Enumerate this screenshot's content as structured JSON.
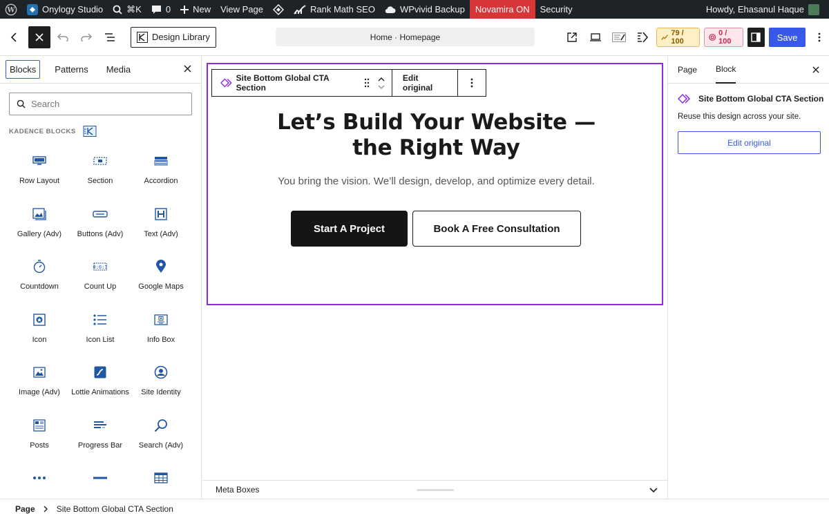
{
  "adminbar": {
    "site_name": "Onylogy Studio",
    "shortcut": "⌘K",
    "comments_count": "0",
    "new_label": "New",
    "view_page": "View Page",
    "rank_math": "Rank Math SEO",
    "wpvivid": "WPvivid Backup",
    "novamira": "Novamira ON",
    "security": "Security",
    "greeting": "Howdy, Ehasanul Haque"
  },
  "header": {
    "design_library": "Design Library",
    "doc_title": "Home · Homepage",
    "score_seo": "79 / 100",
    "score_other": "0 / 100",
    "save": "Save"
  },
  "left_panel": {
    "tabs": [
      "Blocks",
      "Patterns",
      "Media"
    ],
    "search_placeholder": "Search",
    "section_heading": "KADENCE BLOCKS",
    "blocks": [
      {
        "label": "Row Layout",
        "icon": "row-layout-icon"
      },
      {
        "label": "Section",
        "icon": "section-icon"
      },
      {
        "label": "Accordion",
        "icon": "accordion-icon"
      },
      {
        "label": "Gallery (Adv)",
        "icon": "gallery-icon"
      },
      {
        "label": "Buttons (Adv)",
        "icon": "buttons-icon"
      },
      {
        "label": "Text (Adv)",
        "icon": "text-icon"
      },
      {
        "label": "Countdown",
        "icon": "countdown-icon"
      },
      {
        "label": "Count Up",
        "icon": "count-up-icon"
      },
      {
        "label": "Google Maps",
        "icon": "map-pin-icon"
      },
      {
        "label": "Icon",
        "icon": "icon-block-icon"
      },
      {
        "label": "Icon List",
        "icon": "icon-list-icon"
      },
      {
        "label": "Info Box",
        "icon": "info-box-icon"
      },
      {
        "label": "Image (Adv)",
        "icon": "image-icon"
      },
      {
        "label": "Lottie Animations",
        "icon": "lottie-icon"
      },
      {
        "label": "Site Identity",
        "icon": "site-identity-icon"
      },
      {
        "label": "Posts",
        "icon": "posts-icon"
      },
      {
        "label": "Progress Bar",
        "icon": "progress-bar-icon"
      },
      {
        "label": "Search (Adv)",
        "icon": "search-adv-icon"
      }
    ]
  },
  "canvas": {
    "toolbar_block_name": "Site Bottom Global CTA Section",
    "toolbar_edit": "Edit original",
    "title_line1": "Let’s Build Your Website —",
    "title_line2": "the Right Way",
    "subtitle": "You bring the vision. We’ll design, develop, and optimize every detail.",
    "primary_button": "Start A Project",
    "secondary_button": "Book A Free Consultation"
  },
  "meta_boxes": "Meta Boxes",
  "right_panel": {
    "tabs": [
      "Page",
      "Block"
    ],
    "block_title": "Site Bottom Global CTA Section",
    "description": "Reuse this design across your site.",
    "edit_button": "Edit original"
  },
  "footer": {
    "crumb_root": "Page",
    "crumb_current": "Site Bottom Global CTA Section"
  },
  "colors": {
    "accent": "#3858e9",
    "selection": "#8a2be2",
    "novamira": "#d63638",
    "block_icon": "#2156a5"
  }
}
